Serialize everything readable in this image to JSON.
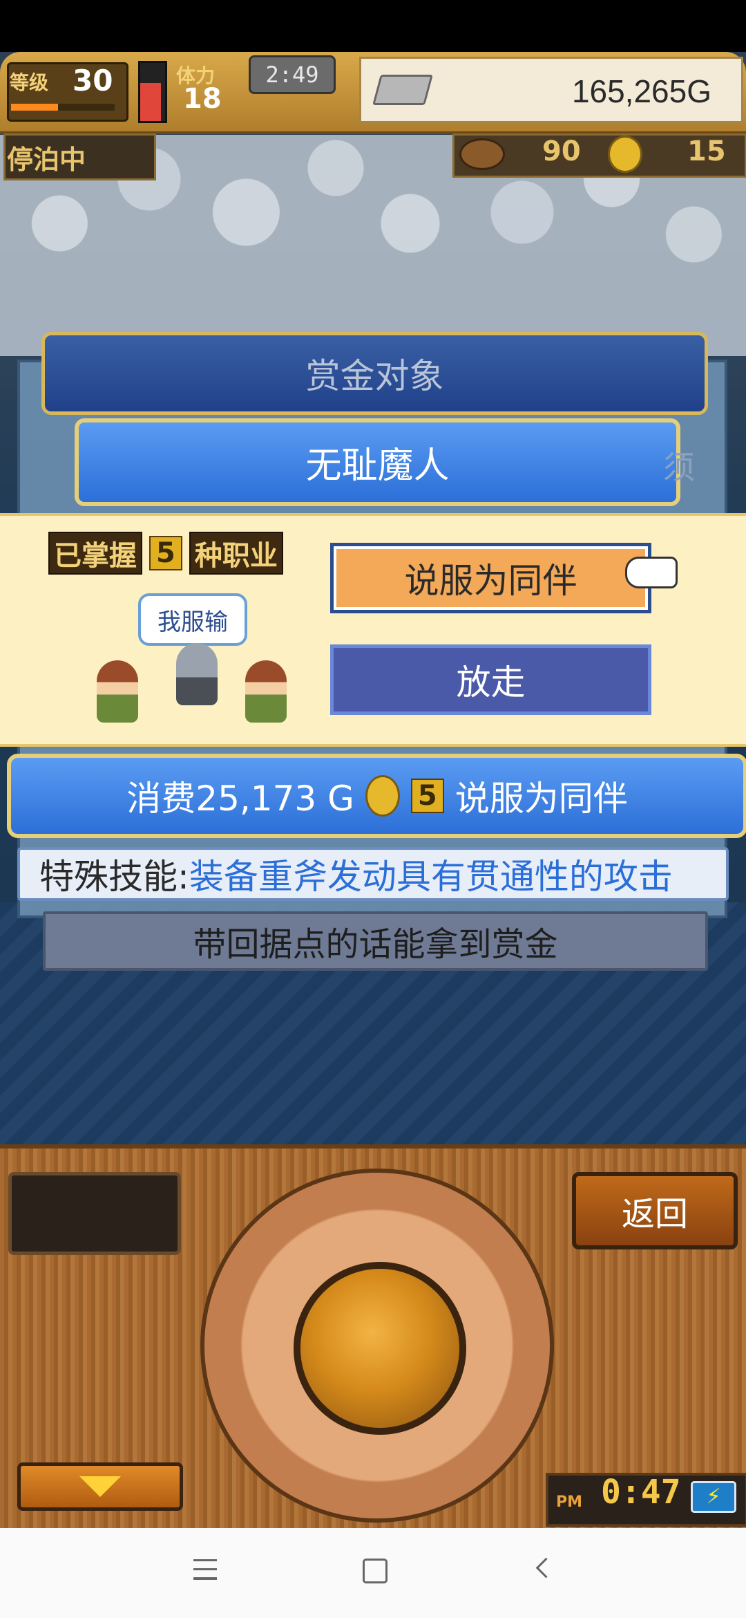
{
  "hud": {
    "level_label": "等级",
    "level_value": "30",
    "level_progress": 0.45,
    "stamina_label": "体力",
    "stamina_value": "18",
    "stamina_fill": 0.65,
    "clock": "2:49",
    "gold": "165,265G"
  },
  "status": {
    "dock_label": "停泊中",
    "resource_1": "90",
    "resource_2": "15"
  },
  "dialog": {
    "title": "赏金对象",
    "target_name": "无耻魔人",
    "side_text": "须",
    "mastered_prefix": "已掌握",
    "mastered_count": "5",
    "mastered_suffix": "种职业",
    "speech_bubble": "我服输",
    "recruit_button": "说服为同伴",
    "release_button": "放走",
    "cost_text": "消费25,173 G",
    "cost_badge": "5",
    "cost_action": "说服为同伴",
    "skill_label": "特殊技能:",
    "skill_value": "装备重斧发动具有贯通性的攻击",
    "reward_note": "带回据点的话能拿到赏金"
  },
  "controls": {
    "back_button": "返回",
    "time_ampm": "PM",
    "time_value": "0:47",
    "battery_glyph": "⚡"
  },
  "icons": {
    "ingot": "silver-ingot-icon",
    "coin": "gold-coin-icon",
    "pointer": "hand-pointer-icon",
    "down": "arrow-down-icon"
  },
  "colors": {
    "accent_blue": "#2c6fd8",
    "highlight_orange": "#f4a959",
    "panel_cream": "#fdf0c2",
    "skill_blue_text": "#2a6ed8"
  }
}
